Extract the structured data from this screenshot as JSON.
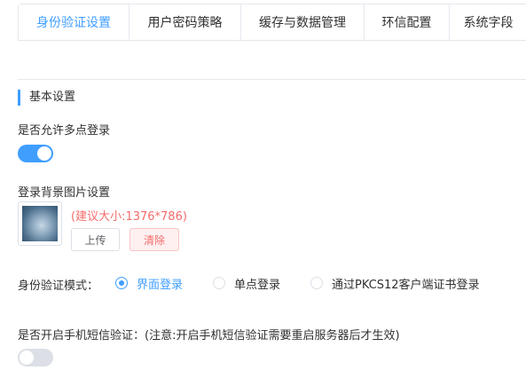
{
  "tabs": [
    {
      "label": "身份验证设置",
      "active": true
    },
    {
      "label": "用户密码策略",
      "active": false
    },
    {
      "label": "缓存与数据管理",
      "active": false
    },
    {
      "label": "环信配置",
      "active": false
    },
    {
      "label": "系统字段",
      "active": false
    }
  ],
  "section": {
    "title": "基本设置"
  },
  "multi_login": {
    "label": "是否允许多点登录",
    "enabled": true
  },
  "background": {
    "label": "登录背景图片设置",
    "hint": "(建议大小:1376*786)",
    "upload_label": "上传",
    "clear_label": "清除"
  },
  "auth_mode": {
    "label": "身份验证模式：",
    "options": [
      {
        "label": "界面登录",
        "checked": true
      },
      {
        "label": "单点登录",
        "checked": false
      },
      {
        "label": "通过PKCS12客户端证书登录",
        "checked": false
      }
    ]
  },
  "sms": {
    "label": "是否开启手机短信验证：(注意:开启手机短信验证需要重启服务器后才生效)",
    "enabled": false
  },
  "colors": {
    "accent": "#409eff",
    "danger": "#f56c6c"
  }
}
